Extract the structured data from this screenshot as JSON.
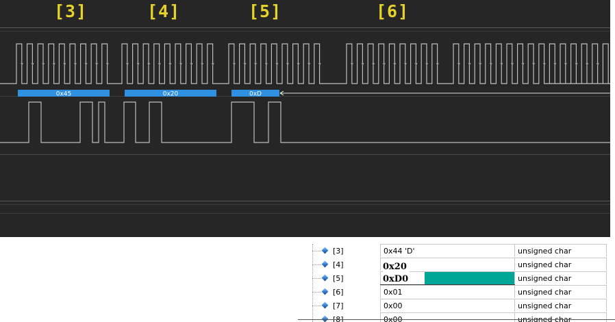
{
  "analyzer": {
    "frame_labels": [
      "[3]",
      "[4]",
      "[5]",
      "[6]"
    ],
    "bus_values": [
      "0x45",
      "0x20",
      "0xD"
    ],
    "colors": {
      "background": "#262626",
      "trace": "#bfbfbf",
      "bus_fill": "#2f8fe0",
      "label": "#e6d22b"
    }
  },
  "watch_table": {
    "rows": [
      {
        "name": "[3]",
        "value": "0x44 'D'",
        "type": "unsigned char"
      },
      {
        "name": "[4]",
        "value": "",
        "type": "unsigned char"
      },
      {
        "name": "[5]",
        "value": "",
        "type": "unsigned char"
      },
      {
        "name": "[6]",
        "value": "0x01",
        "type": "unsigned char"
      },
      {
        "name": "[7]",
        "value": "0x00",
        "type": "unsigned char"
      },
      {
        "name": "[8]",
        "value": "0x00",
        "type": "unsigned char"
      }
    ],
    "annotations": {
      "line1": "0x20",
      "line2": "0xD0"
    },
    "highlight_color": "#00a796"
  }
}
